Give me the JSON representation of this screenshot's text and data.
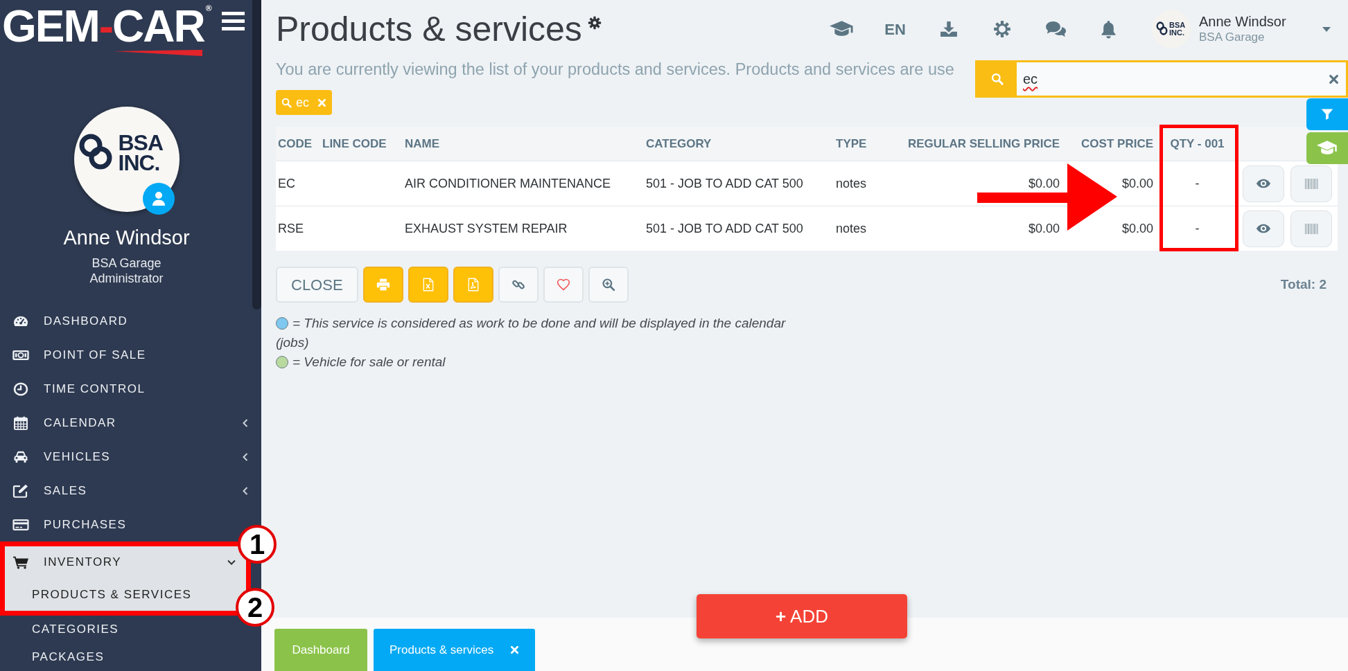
{
  "sidebar": {
    "logo": {
      "left": "GEM",
      "dash": "-",
      "right": "CAR",
      "mark": "®"
    },
    "profile": {
      "logo_lines": [
        "BSA",
        "INC."
      ],
      "name": "Anne Windsor",
      "company": "BSA Garage",
      "role": "Administrator"
    },
    "menu": [
      {
        "label": "DASHBOARD",
        "kind": "link",
        "selected": false
      },
      {
        "label": "POINT OF SALE",
        "kind": "link",
        "selected": false
      },
      {
        "label": "TIME CONTROL",
        "kind": "link",
        "selected": false
      },
      {
        "label": "CALENDAR",
        "kind": "group",
        "expanded": false,
        "selected": false
      },
      {
        "label": "VEHICLES",
        "kind": "group",
        "expanded": false,
        "selected": false
      },
      {
        "label": "SALES",
        "kind": "group",
        "expanded": false,
        "selected": false
      },
      {
        "label": "PURCHASES",
        "kind": "link",
        "selected": false
      },
      {
        "label": "INVENTORY",
        "kind": "group",
        "expanded": true,
        "selected": true,
        "children": [
          {
            "label": "PRODUCTS & SERVICES",
            "selected": true
          },
          {
            "label": "CATEGORIES",
            "selected": false
          },
          {
            "label": "PACKAGES",
            "selected": false
          }
        ]
      }
    ]
  },
  "header": {
    "title": "Products & services",
    "description": "You are currently viewing the list of your products and services. Products and services are use",
    "language": "EN",
    "user": {
      "logo_lines": [
        "BSA",
        "INC."
      ],
      "name": "Anne Windsor",
      "company": "BSA Garage"
    }
  },
  "search": {
    "value": "ec",
    "misspelled": true
  },
  "filter_chips": [
    {
      "text": "ec"
    }
  ],
  "table": {
    "columns": [
      "CODE",
      "LINE CODE",
      "NAME",
      "CATEGORY",
      "TYPE",
      "REGULAR SELLING PRICE",
      "COST PRICE",
      "QTY - 001"
    ],
    "rows": [
      {
        "code": "EC",
        "name": "AIR CONDITIONER MAINTENANCE",
        "category": "501 - JOB TO ADD CAT 500",
        "type": "notes",
        "regular_selling_price": "$0.00",
        "cost_price": "$0.00",
        "qty_001": "-"
      },
      {
        "code": "RSE",
        "name": "EXHAUST SYSTEM REPAIR",
        "category": "501 - JOB TO ADD CAT 500",
        "type": "notes",
        "regular_selling_price": "$0.00",
        "cost_price": "$0.00",
        "qty_001": "-"
      }
    ]
  },
  "toolbar": {
    "buttons": [
      {
        "label": "CLOSE",
        "primary": false
      },
      {
        "primary": true
      },
      {
        "primary": true
      },
      {
        "primary": true
      },
      {
        "primary": false
      },
      {
        "primary": false
      },
      {
        "primary": false
      }
    ],
    "total": "Total: 2"
  },
  "legend": [
    {
      "color": "#7fc8ef",
      "text": "= This service is considered as work to be done and will be displayed in the calendar (jobs)"
    },
    {
      "color": "#b9d99f",
      "text": "= Vehicle for sale or rental"
    }
  ],
  "footer_tabs": [
    {
      "label": "Dashboard",
      "selected": false,
      "closable": false
    },
    {
      "label": "Products & services",
      "selected": true,
      "closable": true
    }
  ],
  "add_button": {
    "label": "**+** ADD"
  },
  "annotations": {
    "markers": [
      "1",
      "2"
    ]
  }
}
